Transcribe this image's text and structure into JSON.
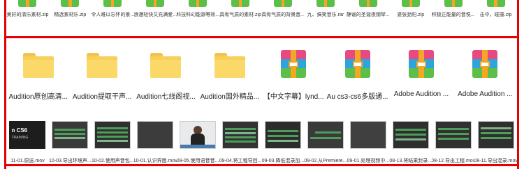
{
  "row1_items": [
    {
      "label": "美好的清乐素材.zip"
    },
    {
      "label": "精选素材乐.zip"
    },
    {
      "label": "令人难以忘怀的景..."
    },
    {
      "label": "浪漫轻快又充满爱..."
    },
    {
      "label": "科技科幻能源等效..."
    },
    {
      "label": "具有气质的素材.zip"
    },
    {
      "label": "具有气质的背景音..."
    },
    {
      "label": "九、搞笑音乐.rar"
    },
    {
      "label": "静谧的圣诞夜钢琴..."
    },
    {
      "label": "婆张劲阳.zip"
    },
    {
      "label": "积极正能量的音悦..."
    },
    {
      "label": "击中，碰撞.zip"
    }
  ],
  "row2_items": [
    {
      "label": "Audition原创高清...",
      "icon": "folder-icon"
    },
    {
      "label": "Audition提取干声...",
      "icon": "folder-icon"
    },
    {
      "label": "Audition七线阁视...",
      "icon": "folder-icon"
    },
    {
      "label": "Audition国外精品...",
      "icon": "folder-icon"
    },
    {
      "label": "【中文字幕】lynd...",
      "icon": "archive-icon"
    },
    {
      "label": "Au cs3-cs6多版通...",
      "icon": "archive-icon"
    },
    {
      "label": "Adobe Audition ...",
      "icon": "archive-icon"
    },
    {
      "label": "Adobe Audition ...",
      "icon": "archive-icon"
    }
  ],
  "row3_items": [
    {
      "label": "11-01.原送.mov",
      "thumb_text": "n CS6",
      "thumb_sub": "TRAINING"
    },
    {
      "label": "10-03.导出环境声..."
    },
    {
      "label": "10-02.使用声音包..."
    },
    {
      "label": "10-01.认识界面.mov"
    },
    {
      "label": "09-05.使用语音音..."
    },
    {
      "label": "09-04.将工程导回..."
    },
    {
      "label": "09-03.降低混录加..."
    },
    {
      "label": "09-02.从Premiere..."
    },
    {
      "label": "09-01.处理视频中..."
    },
    {
      "label": "08-13.将结果封录..."
    },
    {
      "label": "08-12.导出工程.mov"
    },
    {
      "label": "08-11.导出混录.mov"
    }
  ],
  "colors": {
    "accent_rule": "#e60000"
  }
}
